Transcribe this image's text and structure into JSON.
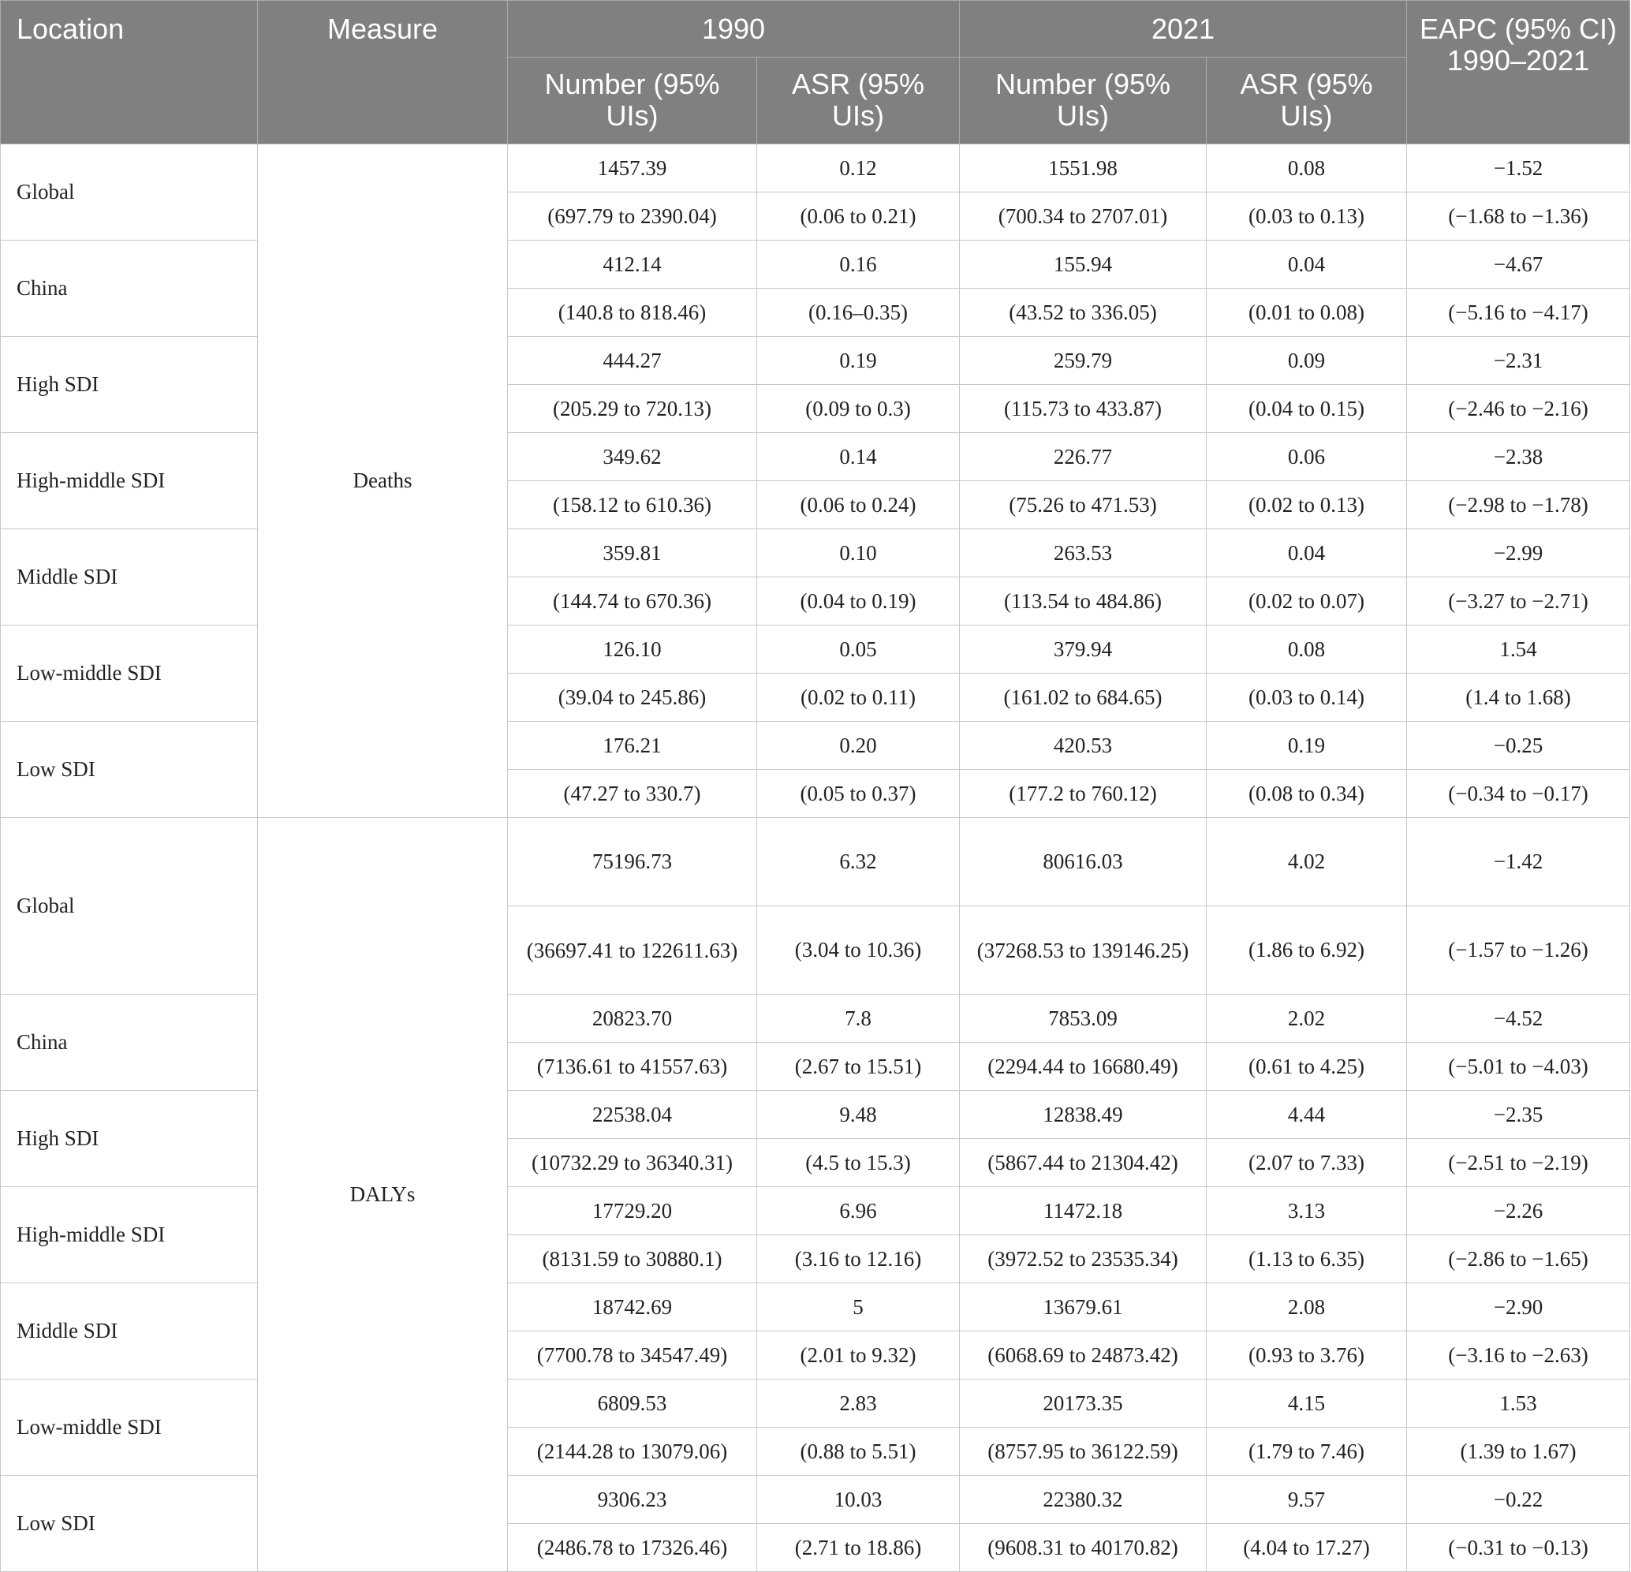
{
  "header": {
    "location": "Location",
    "measure": "Measure",
    "year1990": "1990",
    "year2021": "2021",
    "eapc": "EAPC (95% CI) 1990–2021",
    "number": "Number (95% UIs)",
    "asr": "ASR (95% UIs)"
  },
  "groups": [
    {
      "measure": "Deaths",
      "rows": [
        {
          "location": "Global",
          "n1990": "1457.39",
          "n1990_ci": "(697.79 to 2390.04)",
          "a1990": "0.12",
          "a1990_ci": "(0.06 to 0.21)",
          "n2021": "1551.98",
          "n2021_ci": "(700.34 to 2707.01)",
          "a2021": "0.08",
          "a2021_ci": "(0.03 to 0.13)",
          "eapc": "−1.52",
          "eapc_ci": "(−1.68 to −1.36)"
        },
        {
          "location": "China",
          "n1990": "412.14",
          "n1990_ci": "(140.8 to 818.46)",
          "a1990": "0.16",
          "a1990_ci": "(0.16–0.35)",
          "n2021": "155.94",
          "n2021_ci": "(43.52 to 336.05)",
          "a2021": "0.04",
          "a2021_ci": "(0.01 to 0.08)",
          "eapc": "−4.67",
          "eapc_ci": "(−5.16 to −4.17)"
        },
        {
          "location": "High SDI",
          "n1990": "444.27",
          "n1990_ci": "(205.29 to 720.13)",
          "a1990": "0.19",
          "a1990_ci": "(0.09 to 0.3)",
          "n2021": "259.79",
          "n2021_ci": "(115.73 to 433.87)",
          "a2021": "0.09",
          "a2021_ci": "(0.04 to 0.15)",
          "eapc": "−2.31",
          "eapc_ci": "(−2.46 to −2.16)"
        },
        {
          "location": "High-middle SDI",
          "n1990": "349.62",
          "n1990_ci": "(158.12 to 610.36)",
          "a1990": "0.14",
          "a1990_ci": "(0.06 to 0.24)",
          "n2021": "226.77",
          "n2021_ci": "(75.26 to 471.53)",
          "a2021": "0.06",
          "a2021_ci": "(0.02 to 0.13)",
          "eapc": "−2.38",
          "eapc_ci": "(−2.98 to −1.78)"
        },
        {
          "location": "Middle SDI",
          "n1990": "359.81",
          "n1990_ci": "(144.74 to 670.36)",
          "a1990": "0.10",
          "a1990_ci": "(0.04 to 0.19)",
          "n2021": "263.53",
          "n2021_ci": "(113.54 to 484.86)",
          "a2021": "0.04",
          "a2021_ci": "(0.02 to 0.07)",
          "eapc": "−2.99",
          "eapc_ci": "(−3.27 to −2.71)"
        },
        {
          "location": "Low-middle SDI",
          "n1990": "126.10",
          "n1990_ci": "(39.04 to 245.86)",
          "a1990": "0.05",
          "a1990_ci": "(0.02 to 0.11)",
          "n2021": "379.94",
          "n2021_ci": "(161.02 to 684.65)",
          "a2021": "0.08",
          "a2021_ci": "(0.03 to 0.14)",
          "eapc": "1.54",
          "eapc_ci": "(1.4 to 1.68)"
        },
        {
          "location": "Low SDI",
          "n1990": "176.21",
          "n1990_ci": "(47.27 to 330.7)",
          "a1990": "0.20",
          "a1990_ci": "(0.05 to 0.37)",
          "n2021": "420.53",
          "n2021_ci": "(177.2 to 760.12)",
          "a2021": "0.19",
          "a2021_ci": "(0.08 to 0.34)",
          "eapc": "−0.25",
          "eapc_ci": "(−0.34 to −0.17)"
        }
      ]
    },
    {
      "measure": "DALYs",
      "rows": [
        {
          "location": "Global",
          "n1990": "75196.73",
          "n1990_ci": "(36697.41 to 122611.63)",
          "a1990": "6.32",
          "a1990_ci": "(3.04 to 10.36)",
          "n2021": "80616.03",
          "n2021_ci": "(37268.53 to 139146.25)",
          "a2021": "4.02",
          "a2021_ci": "(1.86 to 6.92)",
          "eapc": "−1.42",
          "eapc_ci": "(−1.57 to −1.26)"
        },
        {
          "location": "China",
          "n1990": "20823.70",
          "n1990_ci": "(7136.61 to 41557.63)",
          "a1990": "7.8",
          "a1990_ci": "(2.67 to 15.51)",
          "n2021": "7853.09",
          "n2021_ci": "(2294.44 to 16680.49)",
          "a2021": "2.02",
          "a2021_ci": "(0.61 to 4.25)",
          "eapc": "−4.52",
          "eapc_ci": "(−5.01 to −4.03)"
        },
        {
          "location": "High SDI",
          "n1990": "22538.04",
          "n1990_ci": "(10732.29 to 36340.31)",
          "a1990": "9.48",
          "a1990_ci": "(4.5 to 15.3)",
          "n2021": "12838.49",
          "n2021_ci": "(5867.44 to 21304.42)",
          "a2021": "4.44",
          "a2021_ci": "(2.07 to 7.33)",
          "eapc": "−2.35",
          "eapc_ci": "(−2.51 to −2.19)"
        },
        {
          "location": "High-middle SDI",
          "n1990": "17729.20",
          "n1990_ci": "(8131.59 to 30880.1)",
          "a1990": "6.96",
          "a1990_ci": "(3.16 to 12.16)",
          "n2021": "11472.18",
          "n2021_ci": "(3972.52 to 23535.34)",
          "a2021": "3.13",
          "a2021_ci": "(1.13 to 6.35)",
          "eapc": "−2.26",
          "eapc_ci": "(−2.86 to −1.65)"
        },
        {
          "location": "Middle SDI",
          "n1990": "18742.69",
          "n1990_ci": "(7700.78 to 34547.49)",
          "a1990": "5",
          "a1990_ci": "(2.01 to 9.32)",
          "n2021": "13679.61",
          "n2021_ci": "(6068.69 to 24873.42)",
          "a2021": "2.08",
          "a2021_ci": "(0.93 to 3.76)",
          "eapc": "−2.90",
          "eapc_ci": "(−3.16 to −2.63)"
        },
        {
          "location": "Low-middle SDI",
          "n1990": "6809.53",
          "n1990_ci": "(2144.28 to 13079.06)",
          "a1990": "2.83",
          "a1990_ci": "(0.88 to 5.51)",
          "n2021": "20173.35",
          "n2021_ci": "(8757.95 to 36122.59)",
          "a2021": "4.15",
          "a2021_ci": "(1.79 to 7.46)",
          "eapc": "1.53",
          "eapc_ci": "(1.39 to 1.67)"
        },
        {
          "location": "Low SDI",
          "n1990": "9306.23",
          "n1990_ci": "(2486.78 to 17326.46)",
          "a1990": "10.03",
          "a1990_ci": "(2.71 to 18.86)",
          "n2021": "22380.32",
          "n2021_ci": "(9608.31 to 40170.82)",
          "a2021": "9.57",
          "a2021_ci": "(4.04 to 17.27)",
          "eapc": "−0.22",
          "eapc_ci": "(−0.31 to −0.13)"
        }
      ]
    }
  ]
}
